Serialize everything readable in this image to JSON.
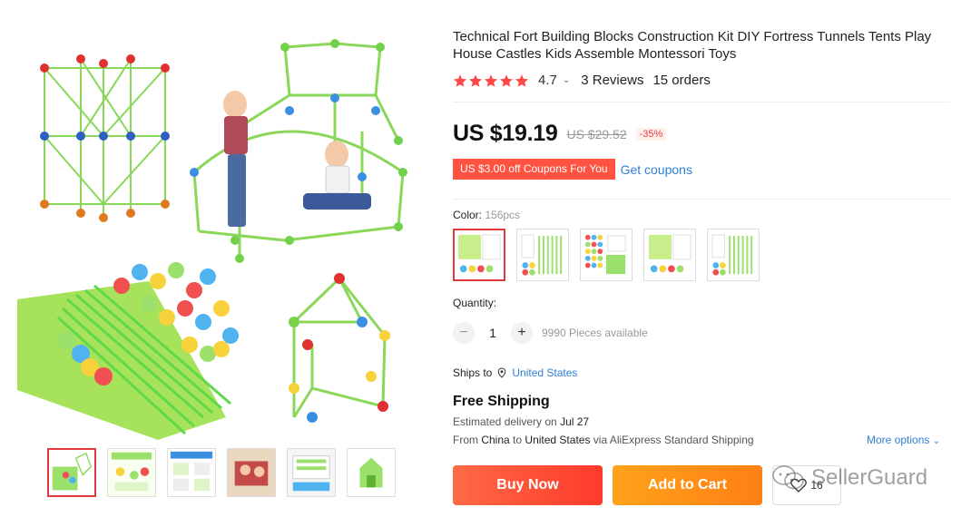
{
  "product": {
    "title": "Technical Fort Building Blocks Construction Kit DIY Fortress Tunnels Tents Play House Castles Kids Assemble Montessori Toys",
    "rating": "4.7",
    "rating_stars": 5,
    "reviews": "3 Reviews",
    "orders": "15 orders"
  },
  "price": {
    "current": "US $19.19",
    "original": "US $29.52",
    "discount": "-35%"
  },
  "coupon": {
    "tag": "US $3.00 off Coupons For You",
    "link": "Get coupons"
  },
  "color": {
    "label": "Color:",
    "selected": "156pcs",
    "swatches": [
      "swatch-1",
      "swatch-2",
      "swatch-3",
      "swatch-4",
      "swatch-5"
    ]
  },
  "quantity": {
    "label": "Quantity:",
    "minus": "−",
    "plus": "+",
    "value": "1",
    "available": "9990 Pieces available"
  },
  "shipping": {
    "ships_to_label": "Ships to",
    "ships_to_value": "United States",
    "free_shipping": "Free Shipping",
    "estimated_label": "Estimated delivery on",
    "estimated_date": "Jul 27",
    "from_word": "From",
    "from_country": "China",
    "to_word": "to",
    "to_country": "United States",
    "via_text": "via AliExpress Standard Shipping",
    "more_options": "More options"
  },
  "actions": {
    "buy_now": "Buy Now",
    "add_to_cart": "Add to Cart",
    "wishlist_count": "16"
  },
  "watermark": "SellerGuard",
  "colors": {
    "accent_red": "#e4393c",
    "link_blue": "#2e7fd6",
    "buy_button": "#ff4a30",
    "cart_button": "#ff9316",
    "tube_green": "#7ddb4a"
  }
}
